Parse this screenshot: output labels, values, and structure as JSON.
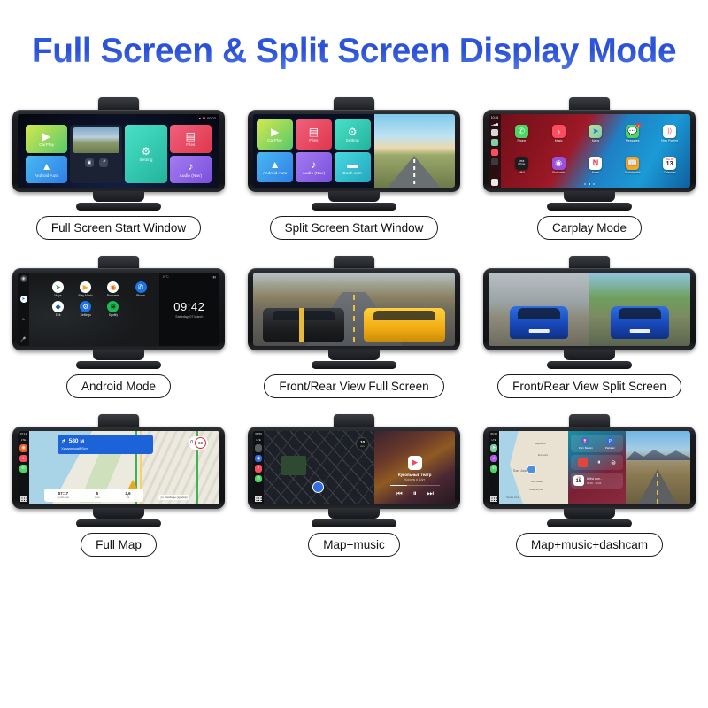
{
  "title": "Full Screen & Split Screen Display Mode",
  "title_color": "#2a4fd6",
  "modes": [
    {
      "id": "full-screen-start",
      "caption": "Full Screen Start Window",
      "status": {
        "rec_dot": "●",
        "timer": "00:02",
        "mic_icon": "mic-icon"
      },
      "tiles": [
        {
          "label": "CarPlay",
          "icon": "carplay-icon",
          "glyph": "▶"
        },
        {
          "label": "Setting",
          "icon": "gear-icon",
          "glyph": "⚙"
        },
        {
          "label": "Files",
          "icon": "image-icon",
          "glyph": "🖼"
        },
        {
          "label": "Android Auto",
          "icon": "android-auto-icon",
          "glyph": "▲"
        },
        {
          "label": "Audio (Nav)",
          "icon": "music-wave-icon",
          "glyph": "♪"
        }
      ],
      "camera_tile": {
        "name": "camera-preview",
        "buttons": [
          "photo-icon",
          "mic-icon"
        ]
      }
    },
    {
      "id": "split-screen-start",
      "caption": "Split Screen Start Window",
      "tiles": [
        {
          "label": "CarPlay",
          "icon": "carplay-icon",
          "glyph": "▶"
        },
        {
          "label": "Files",
          "icon": "image-icon",
          "glyph": "🖼"
        },
        {
          "label": "Setting",
          "icon": "gear-icon",
          "glyph": "⚙"
        },
        {
          "label": "Android Auto",
          "icon": "android-auto-icon",
          "glyph": "▲"
        },
        {
          "label": "Audio (Nav)",
          "icon": "music-wave-icon",
          "glyph": "♪"
        },
        {
          "label": "Dash cam",
          "icon": "video-camera-icon",
          "glyph": "🎥"
        }
      ],
      "right_panel": "road-sunset-camera-view"
    },
    {
      "id": "carplay-mode",
      "caption": "Carplay Mode",
      "sidebar": {
        "time": "10:26",
        "date": "Tue 13",
        "signal": "signal-bars-icon",
        "battery": "battery-icon",
        "shortcuts": [
          "maps-icon",
          "music-icon",
          "settings-icon"
        ],
        "list": "list-icon"
      },
      "apps": [
        {
          "label": "Phone",
          "glyph": "📞",
          "color": "#4cd563",
          "badge": ""
        },
        {
          "label": "Music",
          "glyph": "♪",
          "color": "#fa4d5e",
          "badge": ""
        },
        {
          "label": "Maps",
          "glyph": "➤",
          "color": "#7ed0a0",
          "badge": ""
        },
        {
          "label": "Messages",
          "glyph": "💬",
          "color": "#4cd563",
          "badge": "1"
        },
        {
          "label": "Now Playing",
          "glyph": "))",
          "color": "#ffffff",
          "badge": ""
        },
        {
          "label": "MMI",
          "glyph": "MMI Prime",
          "color": "#1d1d1f",
          "badge": ""
        },
        {
          "label": "Podcasts",
          "glyph": "◉",
          "color": "#9b51e0",
          "badge": ""
        },
        {
          "label": "News",
          "glyph": "N",
          "color": "#ffffff",
          "badge": ""
        },
        {
          "label": "Audiobooks",
          "glyph": "📖",
          "color": "#f5a623",
          "badge": ""
        },
        {
          "label": "Calendar",
          "glyph": "13",
          "color": "#ffffff",
          "badge": ""
        }
      ],
      "page_dots": 3,
      "active_dot": 1
    },
    {
      "id": "android-mode",
      "caption": "Android Mode",
      "sidebar": [
        "home-icon",
        "maps-icon",
        "notification-icon",
        "mic-icon"
      ],
      "apps": [
        {
          "label": "Maps",
          "glyph": "➤",
          "color": "#ffffff"
        },
        {
          "label": "Play Music",
          "glyph": "▶",
          "color": "#ffffff"
        },
        {
          "label": "Podcasts",
          "glyph": "◉",
          "color": "#ffffff"
        },
        {
          "label": "Phone",
          "glyph": "📞",
          "color": "#1a73e8"
        },
        {
          "label": "Exit",
          "glyph": "◆",
          "color": "#ffffff"
        },
        {
          "label": "Settings",
          "glyph": "⚙",
          "color": "#1a73e8"
        },
        {
          "label": "Spotify",
          "glyph": "≋",
          "color": "#1db954"
        }
      ],
      "clock": {
        "time": "09:42",
        "date": "Saturday, 07 March",
        "temp": "19°C",
        "status": "signal-wifi-icon"
      }
    },
    {
      "id": "front-rear-full",
      "caption": "Front/Rear View Full Screen",
      "content": "two-sports-cars-desert-road-photo"
    },
    {
      "id": "front-rear-split",
      "caption": "Front/Rear View Split Screen",
      "content": {
        "left": "blue-car-rear-view",
        "right": "blue-car-front-view"
      }
    },
    {
      "id": "full-map",
      "caption": "Full Map",
      "sidebar": {
        "time": "07:12",
        "network": "LTE",
        "icons": [
          "location-pin-icon",
          "music-icon",
          "phone-icon",
          "apps-grid-icon"
        ]
      },
      "banner": {
        "distance": "580 м",
        "street": "Химкинский бул.",
        "arrow": "turn-right-icon"
      },
      "speed": {
        "current": "0",
        "limit": "60"
      },
      "eta": [
        {
          "value": "07:17",
          "key": "прибытие"
        },
        {
          "value": "5",
          "key": "мин"
        },
        {
          "value": "2,6",
          "key": "км"
        }
      ],
      "street_label": "ул. Свободы (дублёр)"
    },
    {
      "id": "map-music",
      "caption": "Map+music",
      "sidebar": {
        "time": "08:56",
        "network": "LTE",
        "icons": [
          "battery-icon",
          "maps-icon",
          "music-icon",
          "phone-icon",
          "apps-grid-icon"
        ]
      },
      "speed": {
        "value": "10",
        "unit": "км/ч"
      },
      "player": {
        "title": "Кукольный театр",
        "artist": "Король и Шут",
        "controls": [
          "prev-icon",
          "pause-icon",
          "next-icon"
        ],
        "progress_pct": 34
      }
    },
    {
      "id": "map-music-dashcam",
      "caption": "Map+music+dashcam",
      "sidebar": {
        "time": "09:45",
        "network": "LTE",
        "icons": [
          "maps-icon",
          "music-icon",
          "phone-icon",
          "apps-grid-icon"
        ]
      },
      "map_labels": [
        "Hayward",
        "Fremont",
        "San Jose",
        "Los Gatos",
        "Morgan Hill",
        "Santa Cruz"
      ],
      "widgets": {
        "shortcuts": [
          {
            "label": "Pom Bensin",
            "icon": "fuel-icon",
            "glyph": "⛽"
          },
          {
            "label": "Parkiran",
            "icon": "parking-icon",
            "glyph": "P"
          }
        ],
        "music_controls": [
          "pause-icon",
          "stop-icon"
        ],
        "calendar": {
          "day": "15",
          "month": "TUE",
          "event": "Artist wor...",
          "time": "09:00 - 10:00"
        }
      },
      "dashcam": "mountain-highway-view"
    }
  ]
}
